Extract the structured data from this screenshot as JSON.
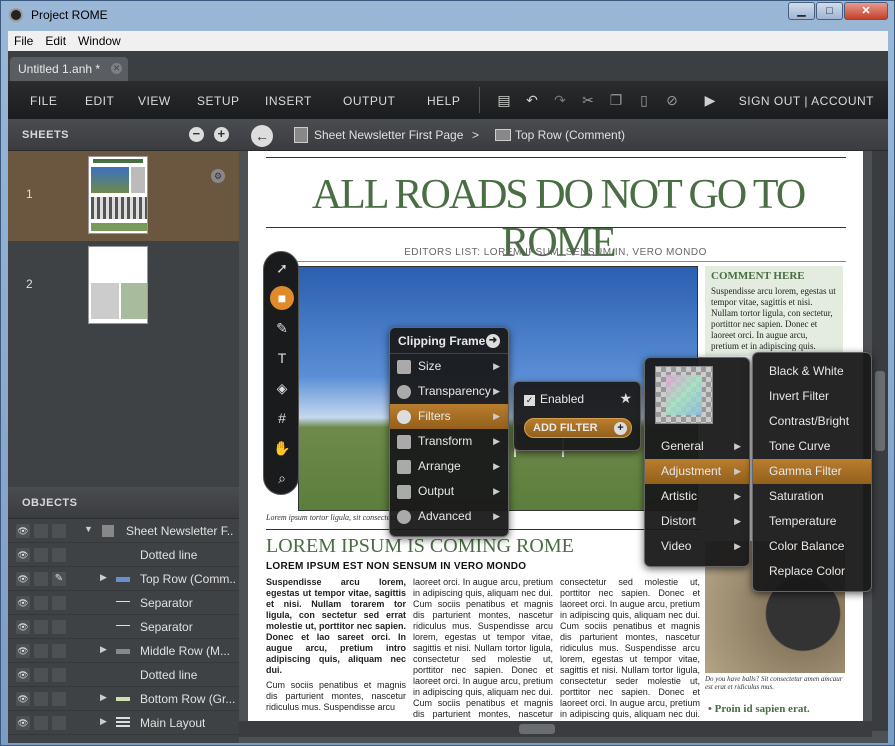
{
  "window": {
    "title": "Project ROME"
  },
  "menubar": {
    "items": [
      "File",
      "Edit",
      "Window"
    ]
  },
  "tab": {
    "label": "Untitled 1.anh *"
  },
  "appmenu": {
    "items": [
      "FILE",
      "EDIT",
      "VIEW",
      "SETUP",
      "INSERT",
      "OUTPUT",
      "HELP"
    ],
    "account": "SIGN OUT | ACCOUNT"
  },
  "sheets": {
    "title": "SHEETS",
    "items": [
      {
        "num": "1"
      },
      {
        "num": "2"
      }
    ]
  },
  "objects": {
    "title": "OBJECTS",
    "items": [
      {
        "label": "Sheet Newsletter F..."
      },
      {
        "label": "Dotted line"
      },
      {
        "label": "Top Row (Comm..."
      },
      {
        "label": "Separator"
      },
      {
        "label": "Separator"
      },
      {
        "label": "Middle Row (M..."
      },
      {
        "label": "Dotted line"
      },
      {
        "label": "Bottom Row (Gr..."
      },
      {
        "label": "Main Layout"
      }
    ]
  },
  "breadcrumb": {
    "page": "Sheet Newsletter First Page",
    "sep": ">",
    "current": "Top Row (Comment)"
  },
  "newsletter": {
    "headline": "ALL ROADS DO NOT GO TO ROME",
    "editors": "EDITORS LIST: LOREM IPSUM, SENSUM IN, VERO MONDO",
    "comment_head": "COMMENT HERE",
    "comment_body": "Suspendisse arcu lorem, egestas ut tempor vitae, sagittis et nisi. Nullam tortor ligula, con sectetur, portittor nec sapien. Donec et laoreet orci. In augue arcu, pretium et in adipiscing quis.",
    "photo_caption": "Lorem ipsum tortor ligula, sit consectetur",
    "lorem_head": "LOREM IPSUM IS COMING ROME",
    "lorem_sub": "LOREM IPSUM EST NON SENSUM IN VERO MONDO",
    "col1_bold": "Suspendisse arcu lorem, egestas ut tempor vitae, sagittis et nisi. Nullam torarem tor ligula, con sectetur sed errat molestie ut, porttitor nec sapien. Donec et lao sareet orci. In augue arcu, pretium intro adipiscing quis, aliquam nec dui.",
    "col1": "Cum sociis penatibus et magnis dis parturient montes, nascetur ridiculus mus. Suspendisse arcu",
    "col2": "laoreet orci. In augue arcu, pretium in adipiscing quis, aliquam nec dui. Cum sociis penatibus et magnis dis parturient montes, nascetur ridiculus mus. Suspendisse arcu lorem, egestas ut tempor vitae, sagittis et nisi. Nullam tortor ligula, consectetur sed molestie ut, porttitor nec sapien. Donec et laoreet orci. In augue arcu, pretium in adipiscing quis, aliquam nec dui. Cum sociis penatibus et magnis dis parturient montes, nascetur ridiculus mus. Suspendisse arcu",
    "col3": "consectetur sed molestie ut, porttitor nec sapien. Donec et laoreet orci. In augue arcu, pretium in adipiscing quis, aliquam nec dui. Cum sociis penatibus et magnis dis parturient montes, nascetur ridiculus mus. Suspendisse arcu lorem, egestas ut tempor vitae, sagittis et nisi. Nullam tortor ligula, consectetur seder molestie ut, porttitor nec sapien. Donec et laoreet orci. In augue arcu, pretium in adipiscing quis, aliquam nec dui. Cum sociis penatibus et magnis dis parturient montes, nascetur",
    "ball_caption": "Do you have balls? Sit consectetur amen amcaur est erat et ridiculus mus.",
    "proin": "• Proin id sapien erat."
  },
  "clip_menu": {
    "title": "Clipping Frame",
    "items": [
      "Size",
      "Transparency",
      "Filters",
      "Transform",
      "Arrange",
      "Output",
      "Advanced"
    ],
    "highlighted": "Filters"
  },
  "filter_menu": {
    "enabled_label": "Enabled",
    "add_label": "ADD FILTER"
  },
  "category_menu": {
    "items": [
      "General",
      "Adjustment",
      "Artistic",
      "Distort",
      "Video"
    ],
    "highlighted": "Adjustment"
  },
  "adjustment_menu": {
    "items": [
      "Black & White",
      "Invert Filter",
      "Contrast/Bright",
      "Tone Curve",
      "Gamma Filter",
      "Saturation",
      "Temperature",
      "Color Balance",
      "Replace Color"
    ],
    "highlighted": "Gamma Filter"
  },
  "colors": {
    "accent": "#b97d2e",
    "headline_green": "#4a6e44",
    "panel": "#3f4245"
  }
}
